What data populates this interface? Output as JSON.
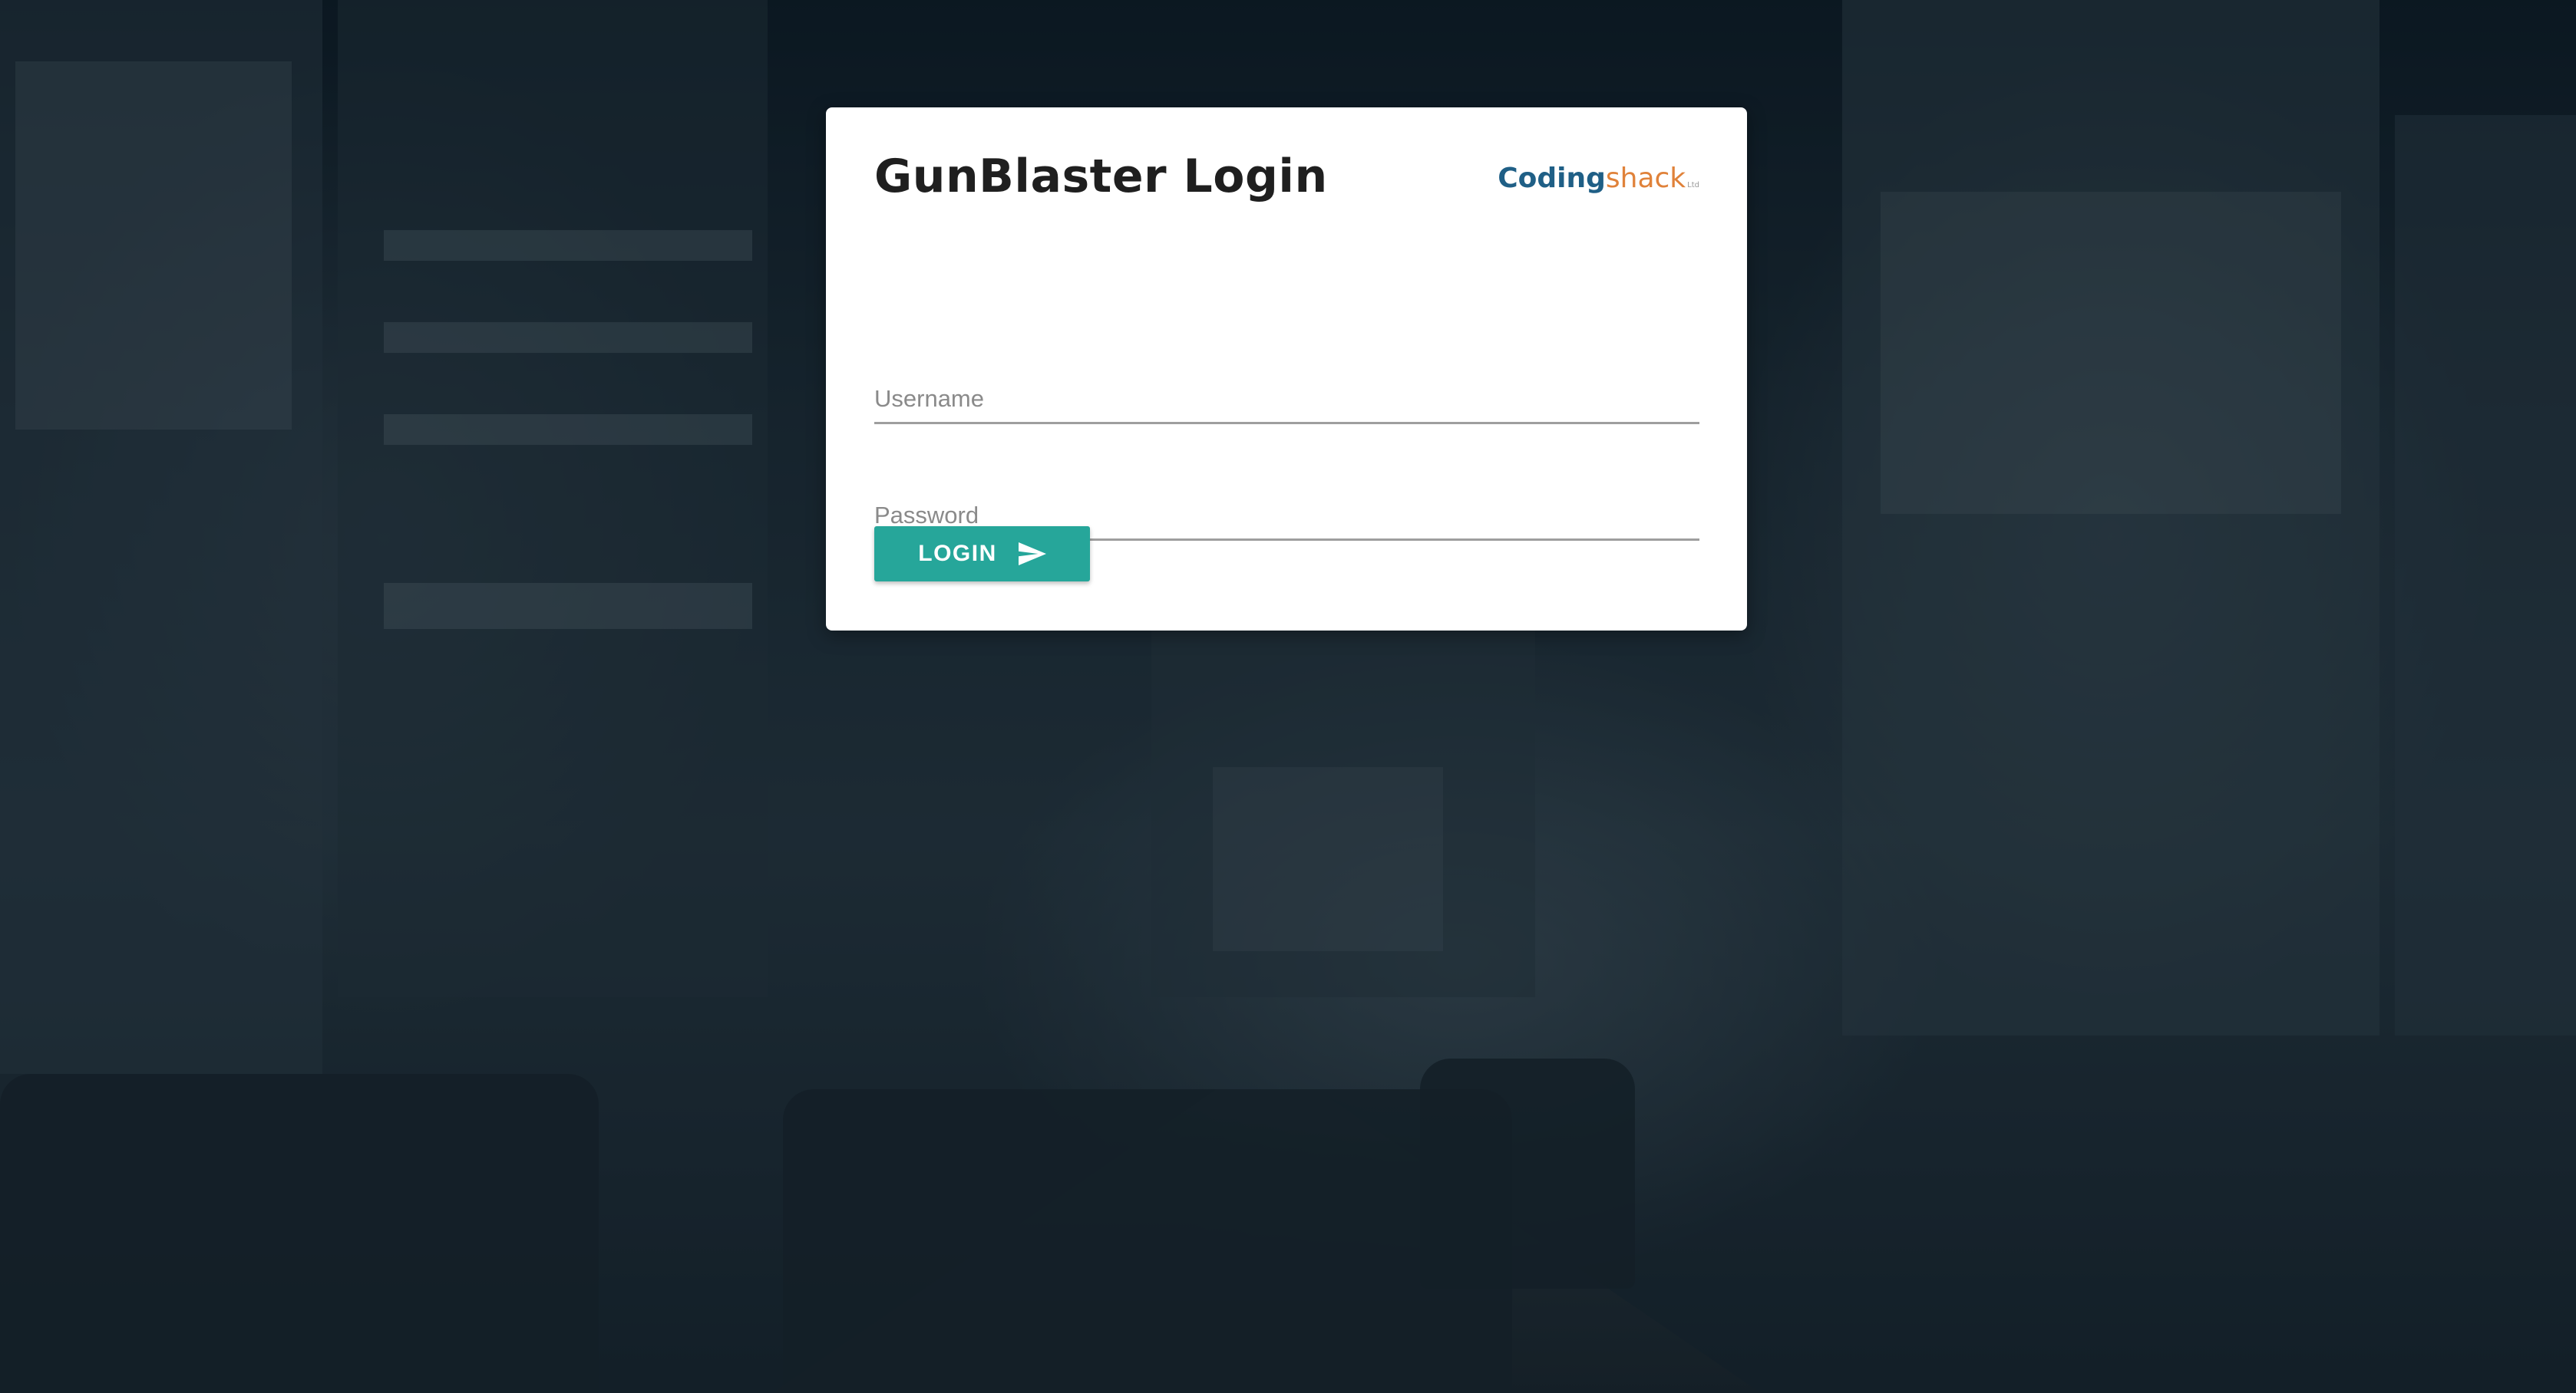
{
  "login_card": {
    "title": "GunBlaster Login",
    "brand": {
      "part1": "Coding",
      "part2": "shack",
      "suffix": "Ltd",
      "color_primary": "#1f5f86",
      "color_secondary": "#e0823a"
    },
    "username": {
      "placeholder": "Username",
      "value": ""
    },
    "password": {
      "placeholder": "Password",
      "value": ""
    },
    "login_button": {
      "label": "LOGIN",
      "icon": "send-icon",
      "color": "#26a69a"
    }
  },
  "background": {
    "description_icon": "city-street-night-photo",
    "overlay_color": "#0a1923"
  }
}
